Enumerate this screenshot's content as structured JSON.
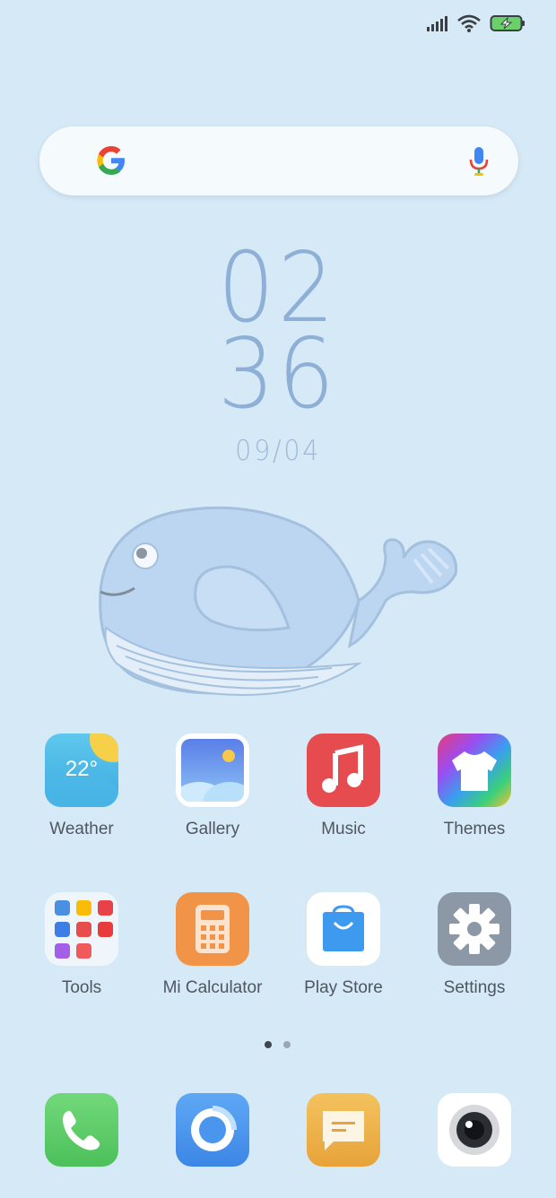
{
  "status_bar": {
    "signal_icon": "signal-icon",
    "wifi_icon": "wifi-icon",
    "battery_icon": "battery-charging-icon"
  },
  "search": {
    "logo_icon": "google-logo-icon",
    "mic_icon": "mic-icon"
  },
  "clock": {
    "hour": "02",
    "minute": "36",
    "date": "09/04"
  },
  "home_apps": [
    {
      "label": "Weather",
      "icon": "weather-icon",
      "temp": "22°"
    },
    {
      "label": "Gallery",
      "icon": "gallery-icon"
    },
    {
      "label": "Music",
      "icon": "music-icon"
    },
    {
      "label": "Themes",
      "icon": "themes-icon"
    },
    {
      "label": "Tools",
      "icon": "tools-folder-icon"
    },
    {
      "label": "Mi Calculator",
      "icon": "calculator-icon"
    },
    {
      "label": "Play Store",
      "icon": "play-store-icon"
    },
    {
      "label": "Settings",
      "icon": "settings-icon"
    }
  ],
  "page_indicator": {
    "pages": 2,
    "active": 1
  },
  "dock": [
    {
      "icon": "phone-icon"
    },
    {
      "icon": "browser-icon"
    },
    {
      "icon": "messages-icon"
    },
    {
      "icon": "camera-icon"
    }
  ],
  "colors": {
    "background": "#d6e9f6",
    "clock": "#8fb0d6",
    "label": "#4f5660"
  }
}
